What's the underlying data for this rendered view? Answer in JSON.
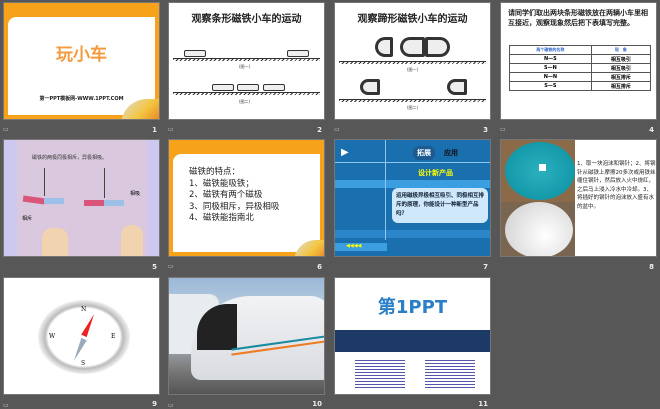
{
  "slides": [
    {
      "num": "1",
      "title": "玩小车",
      "footer": "第一PPT模板网-WWW.1PPT.COM"
    },
    {
      "num": "2",
      "title": "观察条形磁铁小车的运动",
      "captions": [
        "(图一)",
        "(图二)"
      ]
    },
    {
      "num": "3",
      "title": "观察蹄形磁铁小车的运动",
      "captions": [
        "(图一)",
        "(图二)"
      ]
    },
    {
      "num": "4",
      "intro": "请同学们取出两块条形磁铁放在两辆小车里相互接近，观察现象然后把下表填写完整。",
      "table": {
        "headers": [
          "两个磁铁的名称",
          "现　象"
        ],
        "rows": [
          [
            "N—S",
            "相互吸引"
          ],
          [
            "S—N",
            "相互吸引"
          ],
          [
            "N—N",
            "相互排斥"
          ],
          [
            "S—S",
            "相互排斥"
          ]
        ]
      }
    },
    {
      "num": "5",
      "caption": "磁铁的两极同极相斥，异极相吸。",
      "label_attract": "相吸",
      "label_repel": "相斥"
    },
    {
      "num": "6",
      "lines": [
        "磁铁的特点：",
        "1、磁铁能吸铁；",
        "2、磁铁有两个磁极",
        "3、同极相斥，异极相吸",
        "4、磁铁能指南北"
      ]
    },
    {
      "num": "7",
      "tab1": "拓展",
      "tab2": "应用",
      "subtitle": "设计新产品",
      "question": "运用磁极异极相互吸引、同极相互排斥的原理，你能设计一种新型产品吗？"
    },
    {
      "num": "8",
      "steps": "1、取一块泡沫和钢针；2、将钢针从磁铁上摩擦20多次或用铁丝缠住钢针，然后放入火中烧红，之后马上浸入冷水中冷却。3、将插好的钢针的泡沫放入盛有水的盆中。"
    },
    {
      "num": "9",
      "compass": [
        "N",
        "S",
        "W",
        "E"
      ]
    },
    {
      "num": "10"
    },
    {
      "num": "11",
      "logo": "第1PPT"
    }
  ],
  "colors": {
    "bg": "#575757",
    "orange": "#f7a21b",
    "blue": "#1a6fae"
  }
}
